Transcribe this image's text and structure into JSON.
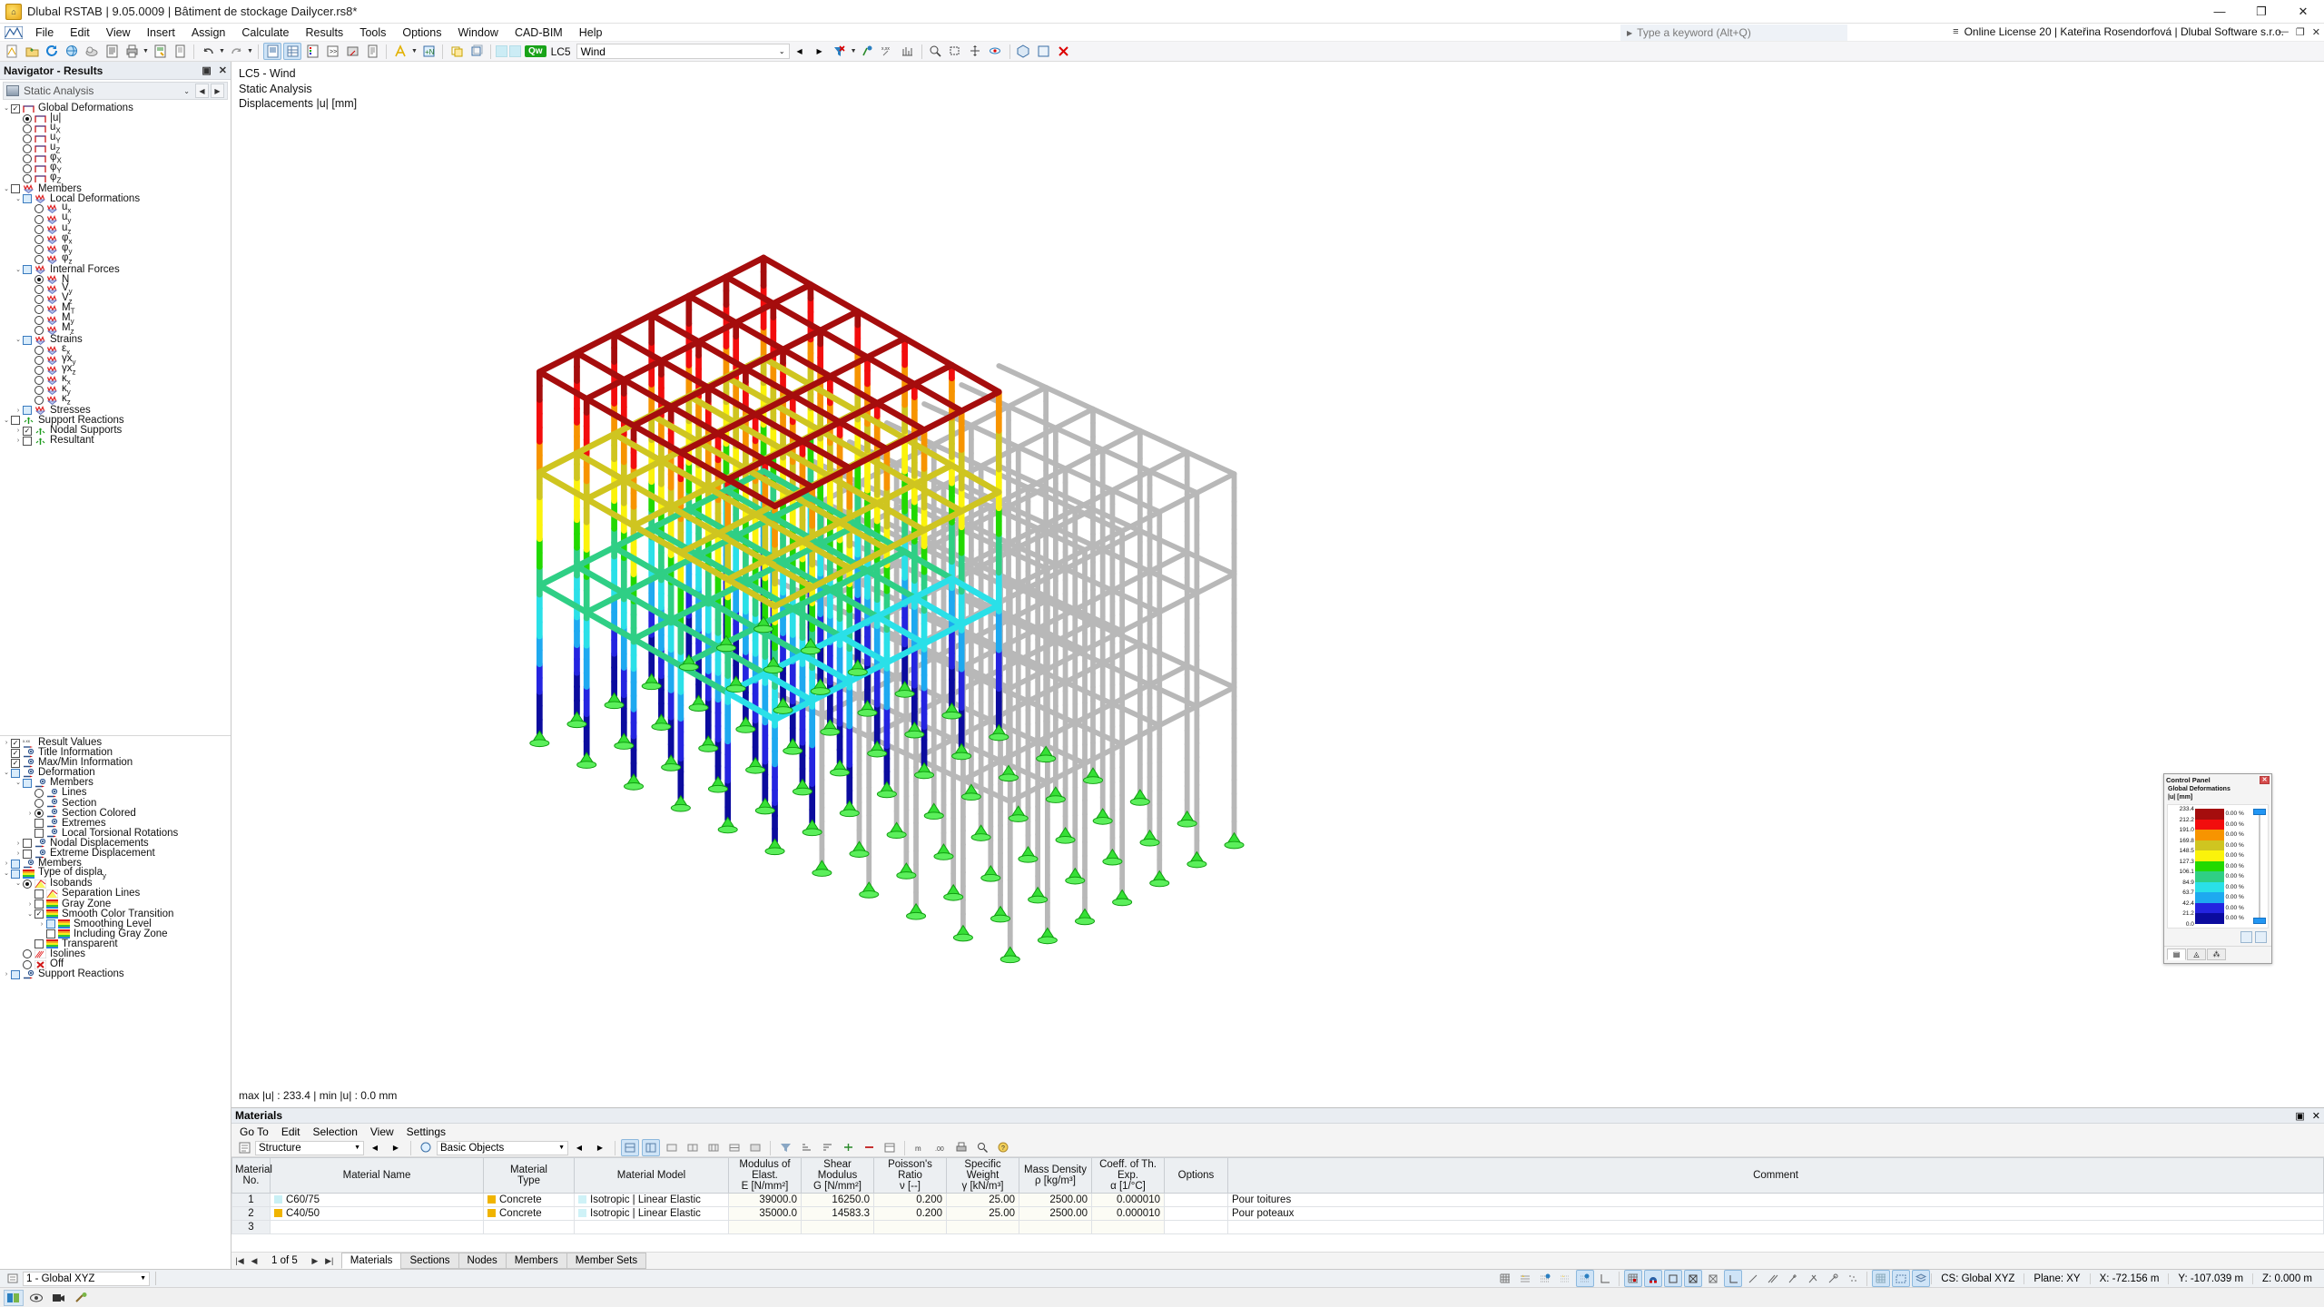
{
  "window": {
    "title": "Dlubal RSTAB | 9.05.0009 | Bâtiment de stockage Dailycer.rs8*",
    "app_icon": "dlubal-icon",
    "minimize": "—",
    "maximize": "❐",
    "close": "✕"
  },
  "menu": {
    "items": [
      "File",
      "Edit",
      "View",
      "Insert",
      "Assign",
      "Calculate",
      "Results",
      "Tools",
      "Options",
      "Window",
      "CAD-BIM",
      "Help"
    ],
    "search_placeholder": "Type a keyword (Alt+Q)",
    "license": "Online License 20 | Kateřina Rosendorfová | Dlubal Software s.r.o.",
    "mini_minimize": "—",
    "mini_restore": "❐",
    "mini_close": "✕"
  },
  "toolbar": {
    "loadcase_badge": "Qw",
    "loadcase_id": "LC5",
    "loadcase_name": "Wind",
    "dropdown_caret": "⌄",
    "prev": "◀",
    "next": "▶"
  },
  "navigator": {
    "title": "Navigator - Results",
    "restore_icon": "▣",
    "close_icon": "✕",
    "selector": "Static Analysis",
    "prev": "◀",
    "next": "▶",
    "tree": [
      {
        "label": "Global Deformations",
        "indent": 0,
        "exp": "v",
        "ctrl": "chk",
        "state": "checked",
        "icon": "frame"
      },
      {
        "label": "|u|",
        "indent": 1,
        "ctrl": "rad",
        "state": "on",
        "icon": "frame"
      },
      {
        "label": "uX",
        "indent": 1,
        "ctrl": "rad",
        "state": "off",
        "icon": "frame"
      },
      {
        "label": "uY",
        "indent": 1,
        "ctrl": "rad",
        "state": "off",
        "icon": "frame"
      },
      {
        "label": "uZ",
        "indent": 1,
        "ctrl": "rad",
        "state": "off",
        "icon": "frame"
      },
      {
        "label": "φX",
        "indent": 1,
        "ctrl": "rad",
        "state": "off",
        "icon": "frame"
      },
      {
        "label": "φY",
        "indent": 1,
        "ctrl": "rad",
        "state": "off",
        "icon": "frame"
      },
      {
        "label": "φZ",
        "indent": 1,
        "ctrl": "rad",
        "state": "off",
        "icon": "frame"
      },
      {
        "label": "Members",
        "indent": 0,
        "exp": "v",
        "ctrl": "chk",
        "state": "empty",
        "icon": "member"
      },
      {
        "label": "Local Deformations",
        "indent": 1,
        "exp": "v",
        "ctrl": "chk",
        "state": "blue",
        "icon": "member"
      },
      {
        "label": "ux",
        "indent": 2,
        "ctrl": "rad",
        "state": "off",
        "icon": "member"
      },
      {
        "label": "uy",
        "indent": 2,
        "ctrl": "rad",
        "state": "off",
        "icon": "member"
      },
      {
        "label": "uz",
        "indent": 2,
        "ctrl": "rad",
        "state": "off",
        "icon": "member"
      },
      {
        "label": "φx",
        "indent": 2,
        "ctrl": "rad",
        "state": "off",
        "icon": "member"
      },
      {
        "label": "φy",
        "indent": 2,
        "ctrl": "rad",
        "state": "off",
        "icon": "member"
      },
      {
        "label": "φz",
        "indent": 2,
        "ctrl": "rad",
        "state": "off",
        "icon": "member"
      },
      {
        "label": "Internal Forces",
        "indent": 1,
        "exp": "v",
        "ctrl": "chk",
        "state": "blue",
        "icon": "member"
      },
      {
        "label": "N",
        "indent": 2,
        "ctrl": "rad",
        "state": "on",
        "icon": "member"
      },
      {
        "label": "Vy",
        "indent": 2,
        "ctrl": "rad",
        "state": "off",
        "icon": "member"
      },
      {
        "label": "Vz",
        "indent": 2,
        "ctrl": "rad",
        "state": "off",
        "icon": "member"
      },
      {
        "label": "MT",
        "indent": 2,
        "ctrl": "rad",
        "state": "off",
        "icon": "member"
      },
      {
        "label": "My",
        "indent": 2,
        "ctrl": "rad",
        "state": "off",
        "icon": "member"
      },
      {
        "label": "Mz",
        "indent": 2,
        "ctrl": "rad",
        "state": "off",
        "icon": "member"
      },
      {
        "label": "Strains",
        "indent": 1,
        "exp": "v",
        "ctrl": "chk",
        "state": "blue",
        "icon": "member"
      },
      {
        "label": "εx",
        "indent": 2,
        "ctrl": "rad",
        "state": "off",
        "icon": "member"
      },
      {
        "label": "γxy",
        "indent": 2,
        "ctrl": "rad",
        "state": "off",
        "icon": "member"
      },
      {
        "label": "γxz",
        "indent": 2,
        "ctrl": "rad",
        "state": "off",
        "icon": "member"
      },
      {
        "label": "κx",
        "indent": 2,
        "ctrl": "rad",
        "state": "off",
        "icon": "member"
      },
      {
        "label": "κy",
        "indent": 2,
        "ctrl": "rad",
        "state": "off",
        "icon": "member"
      },
      {
        "label": "κz",
        "indent": 2,
        "ctrl": "rad",
        "state": "off",
        "icon": "member"
      },
      {
        "label": "Stresses",
        "indent": 1,
        "exp": ">",
        "ctrl": "chk",
        "state": "blue",
        "icon": "member"
      },
      {
        "label": "Support Reactions",
        "indent": 0,
        "exp": "v",
        "ctrl": "chk",
        "state": "empty",
        "icon": "support"
      },
      {
        "label": "Nodal Supports",
        "indent": 1,
        "exp": ">",
        "ctrl": "chk",
        "state": "checked",
        "icon": "support"
      },
      {
        "label": "Resultant",
        "indent": 1,
        "exp": ">",
        "ctrl": "chk",
        "state": "empty",
        "icon": "support"
      }
    ],
    "tree2": [
      {
        "label": "Result Values",
        "indent": 0,
        "exp": ">",
        "ctrl": "chk",
        "state": "checked",
        "icon": "values"
      },
      {
        "label": "Title Information",
        "indent": 0,
        "ctrl": "chk",
        "state": "checked",
        "icon": "eye"
      },
      {
        "label": "Max/Min Information",
        "indent": 0,
        "ctrl": "chk",
        "state": "checked",
        "icon": "eye"
      },
      {
        "label": "Deformation",
        "indent": 0,
        "exp": "v",
        "ctrl": "chk",
        "state": "blue",
        "icon": "eye"
      },
      {
        "label": "Members",
        "indent": 1,
        "exp": "v",
        "ctrl": "chk",
        "state": "blue",
        "icon": "eye"
      },
      {
        "label": "Lines",
        "indent": 2,
        "ctrl": "rad",
        "state": "off",
        "icon": "eye"
      },
      {
        "label": "Section",
        "indent": 2,
        "ctrl": "rad",
        "state": "off",
        "icon": "eye"
      },
      {
        "label": "Section Colored",
        "indent": 2,
        "exp": ">",
        "ctrl": "rad",
        "state": "on",
        "icon": "eye"
      },
      {
        "label": "Extremes",
        "indent": 2,
        "ctrl": "chk",
        "state": "empty",
        "icon": "eye"
      },
      {
        "label": "Local Torsional Rotations",
        "indent": 2,
        "ctrl": "chk",
        "state": "empty",
        "icon": "eye"
      },
      {
        "label": "Nodal Displacements",
        "indent": 1,
        "exp": ">",
        "ctrl": "chk",
        "state": "empty",
        "icon": "eye"
      },
      {
        "label": "Extreme Displacement",
        "indent": 1,
        "exp": ">",
        "ctrl": "chk",
        "state": "empty",
        "icon": "eye"
      },
      {
        "label": "Members",
        "indent": 0,
        "exp": ">",
        "ctrl": "chk",
        "state": "blue",
        "icon": "eye"
      },
      {
        "label": "Type of display",
        "indent": 0,
        "exp": "v",
        "ctrl": "chk",
        "state": "blue",
        "icon": "rainbow"
      },
      {
        "label": "Isobands",
        "indent": 1,
        "exp": "v",
        "ctrl": "rad",
        "state": "on",
        "icon": "isoband"
      },
      {
        "label": "Separation Lines",
        "indent": 2,
        "ctrl": "chk",
        "state": "empty",
        "icon": "isoband"
      },
      {
        "label": "Gray Zone",
        "indent": 2,
        "exp": ">",
        "ctrl": "chk",
        "state": "empty",
        "icon": "rainbow"
      },
      {
        "label": "Smooth Color Transition",
        "indent": 2,
        "exp": "v",
        "ctrl": "chk",
        "state": "checked",
        "icon": "rainbow"
      },
      {
        "label": "Smoothing Level",
        "indent": 3,
        "exp": ">",
        "ctrl": "chk",
        "state": "blue",
        "icon": "rainbow"
      },
      {
        "label": "Including Gray Zone",
        "indent": 3,
        "ctrl": "chk",
        "state": "empty",
        "icon": "rainbow"
      },
      {
        "label": "Transparent",
        "indent": 2,
        "ctrl": "chk",
        "state": "empty",
        "icon": "rainbow"
      },
      {
        "label": "Isolines",
        "indent": 1,
        "ctrl": "rad",
        "state": "off",
        "icon": "isoline"
      },
      {
        "label": "Off",
        "indent": 1,
        "ctrl": "rad",
        "state": "off",
        "icon": "off"
      },
      {
        "label": "Support Reactions",
        "indent": 0,
        "exp": ">",
        "ctrl": "chk",
        "state": "blue",
        "icon": "eye"
      }
    ]
  },
  "viewport": {
    "title_line1": "LC5 - Wind",
    "title_line2": "Static Analysis",
    "title_line3": "Displacements |u| [mm]",
    "minmax": "max |u| : 233.4 | min |u| : 0.0 mm"
  },
  "control_panel": {
    "title": "Control Panel",
    "close_icon": "✕",
    "subtitle_line1": "Global Deformations",
    "subtitle_line2": "|u| [mm]",
    "scale_values": [
      "233.4",
      "212.2",
      "191.0",
      "169.8",
      "148.5",
      "127.3",
      "106.1",
      "84.9",
      "63.7",
      "42.4",
      "21.2",
      "0.0"
    ],
    "band_colors": [
      "#a50d0d",
      "#f20d0d",
      "#f79400",
      "#cfc520",
      "#fbf30b",
      "#22d900",
      "#2fcf85",
      "#2ae0e8",
      "#1ea9f0",
      "#2424e0",
      "#0b0b9e"
    ],
    "percents": [
      "0.00 %",
      "0.00 %",
      "0.00 %",
      "0.00 %",
      "0.00 %",
      "0.00 %",
      "0.00 %",
      "0.00 %",
      "0.00 %",
      "0.00 %",
      "0.00 %"
    ],
    "tabs": [
      "color-scale-tab",
      "display-factors-tab",
      "filter-tab"
    ]
  },
  "table_panel": {
    "title": "Materials",
    "restore_icon": "▣",
    "close_icon": "✕",
    "menu": [
      "Go To",
      "Edit",
      "Selection",
      "View",
      "Settings"
    ],
    "structure_combo": "Structure",
    "objects_combo": "Basic Objects",
    "columns": [
      {
        "l1": "Material",
        "l2": "No."
      },
      {
        "l1": "",
        "l2": "Material Name"
      },
      {
        "l1": "Material",
        "l2": "Type"
      },
      {
        "l1": "",
        "l2": "Material Model"
      },
      {
        "l1": "Modulus of Elast.",
        "l2": "E [N/mm²]"
      },
      {
        "l1": "Shear Modulus",
        "l2": "G [N/mm²]"
      },
      {
        "l1": "Poisson's Ratio",
        "l2": "ν [--]"
      },
      {
        "l1": "Specific Weight",
        "l2": "γ [kN/m³]"
      },
      {
        "l1": "Mass Density",
        "l2": "ρ [kg/m³]"
      },
      {
        "l1": "Coeff. of Th. Exp.",
        "l2": "α [1/°C]"
      },
      {
        "l1": "",
        "l2": "Options"
      },
      {
        "l1": "",
        "l2": "Comment"
      }
    ],
    "rows": [
      {
        "no": "1",
        "name": "C60/75",
        "name_color": "#c9f0f5",
        "type": "Concrete",
        "type_color": "#f0b400",
        "model": "Isotropic | Linear Elastic",
        "model_color": "#cff2f7",
        "E": "39000.0",
        "G": "16250.0",
        "nu": "0.200",
        "gamma": "25.00",
        "rho": "2500.00",
        "alpha": "0.000010",
        "options": "",
        "comment": "Pour toitures",
        "editing": true
      },
      {
        "no": "2",
        "name": "C40/50",
        "name_color": "#f0b400",
        "type": "Concrete",
        "type_color": "#f0b400",
        "model": "Isotropic | Linear Elastic",
        "model_color": "#cff2f7",
        "E": "35000.0",
        "G": "14583.3",
        "nu": "0.200",
        "gamma": "25.00",
        "rho": "2500.00",
        "alpha": "0.000010",
        "options": "",
        "comment": "Pour poteaux",
        "editing": false
      },
      {
        "no": "3",
        "name": "",
        "name_color": "",
        "type": "",
        "type_color": "",
        "model": "",
        "model_color": "",
        "E": "",
        "G": "",
        "nu": "",
        "gamma": "",
        "rho": "",
        "alpha": "",
        "options": "",
        "comment": "",
        "editing": false
      }
    ],
    "pager": "1 of 5",
    "first": "|◀",
    "prev": "◀",
    "next": "▶",
    "last": "▶|",
    "tabs": [
      "Materials",
      "Sections",
      "Nodes",
      "Members",
      "Member Sets"
    ],
    "active_tab": "Materials"
  },
  "statusbar": {
    "view_combo": "1 - Global XYZ",
    "cs": "CS: Global XYZ",
    "plane": "Plane: XY",
    "x": "X: -72.156 m",
    "y": "Y: -107.039 m",
    "z": "Z: 0.000 m"
  }
}
